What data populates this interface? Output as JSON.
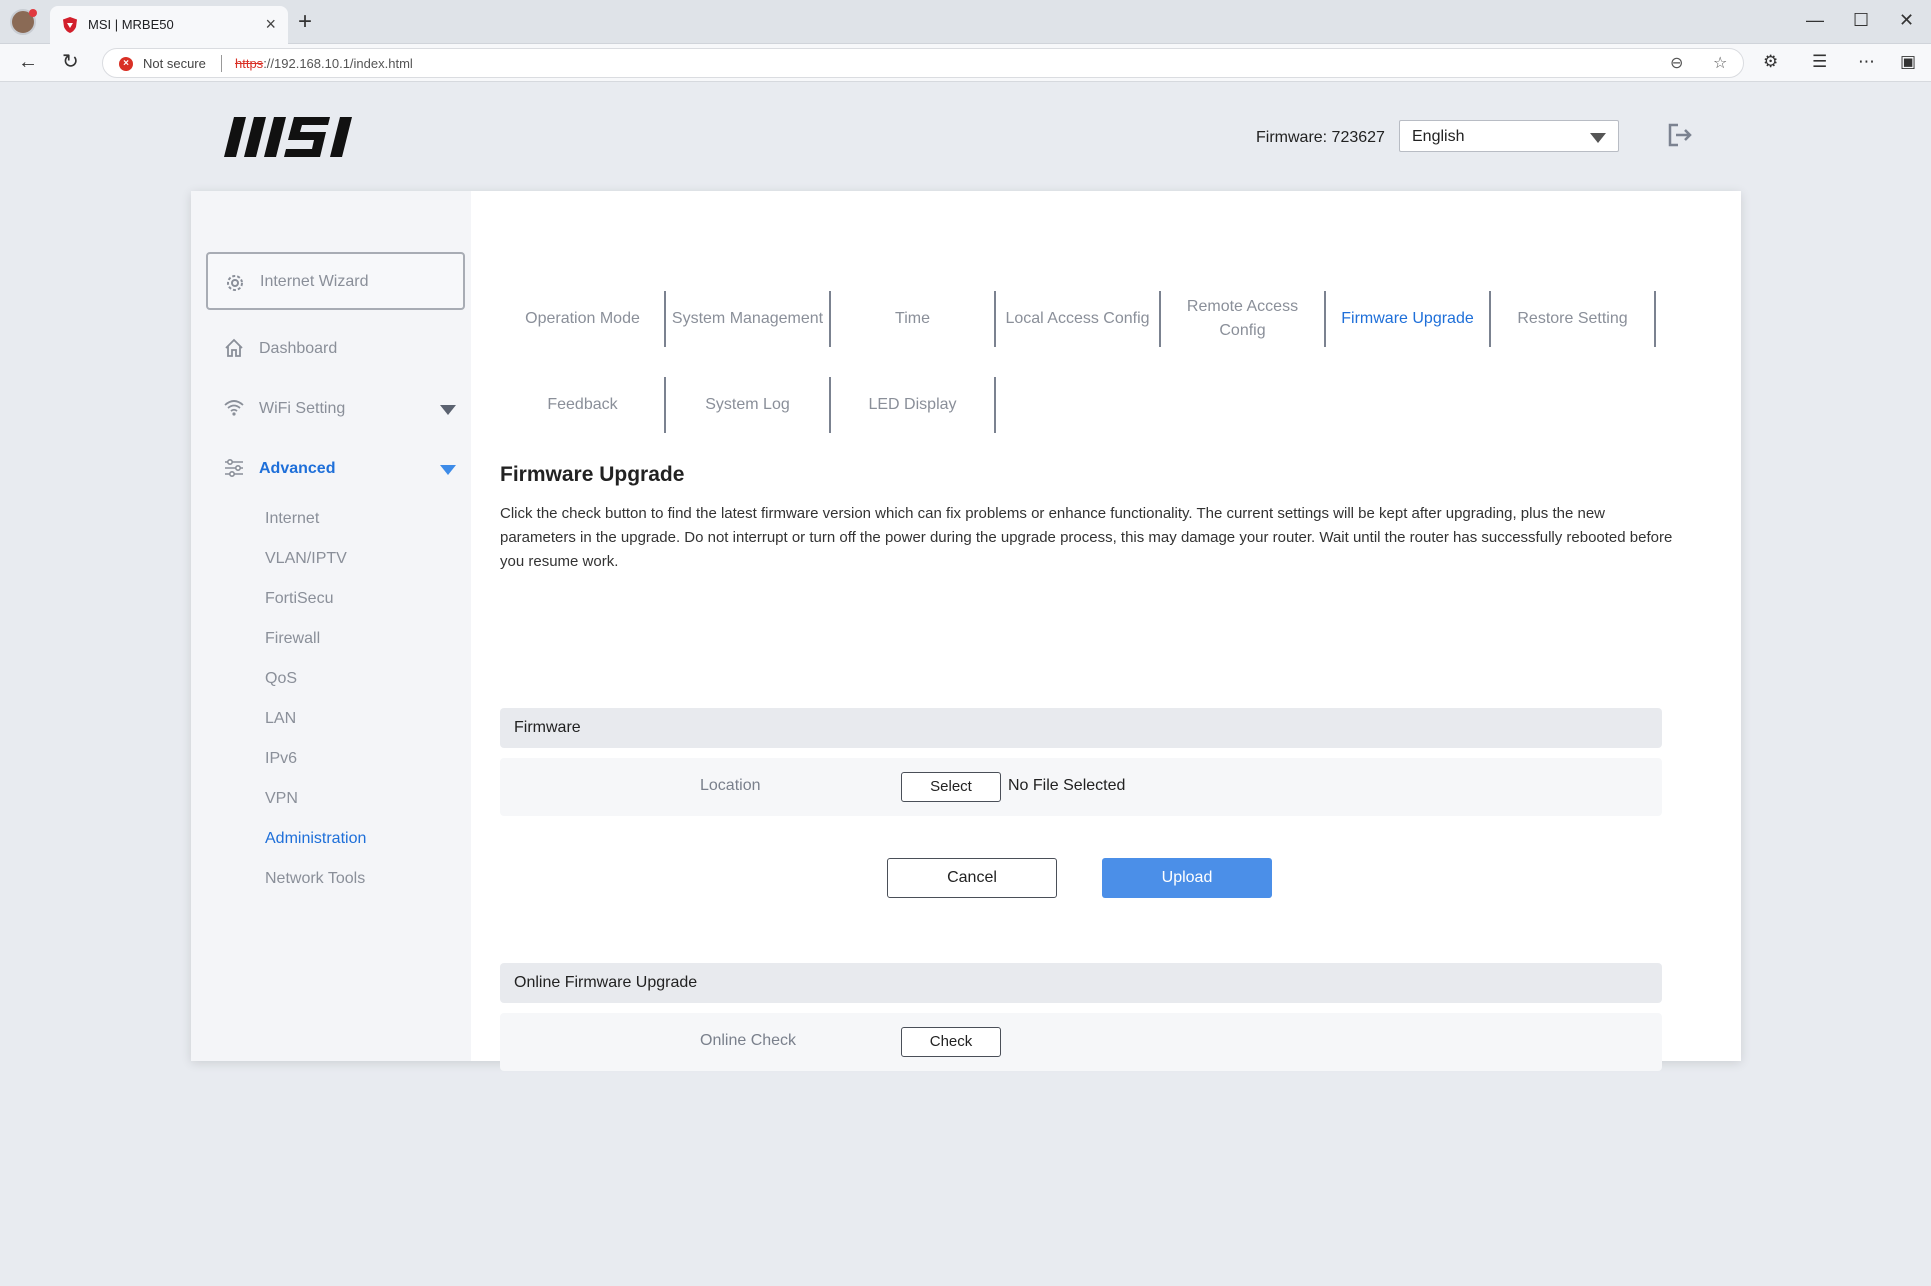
{
  "browser": {
    "tab_title": "MSI | MRBE50",
    "tab_close": "×",
    "new_tab": "+",
    "minimize": "—",
    "maximize": "☐",
    "close": "✕",
    "not_secure": "Not secure",
    "url_scheme": "https",
    "url_rest": "://192.168.10.1/index.html",
    "url_host": "192.168.10.1",
    "url_path": "/index.html"
  },
  "header": {
    "firmware_label": "Firmware: 723627",
    "language": "English"
  },
  "sidebar": {
    "wizard": "Internet Wizard",
    "dashboard": "Dashboard",
    "wifi": "WiFi Setting",
    "advanced": "Advanced",
    "sub_items": [
      "Internet",
      "VLAN/IPTV",
      "FortiSecu",
      "Firewall",
      "QoS",
      "LAN",
      "IPv6",
      "VPN",
      "Administration",
      "Network Tools"
    ]
  },
  "tabs": [
    {
      "label": "Operation Mode"
    },
    {
      "label": "System Management"
    },
    {
      "label": "Time"
    },
    {
      "label": "Local Access Config"
    },
    {
      "label": "Remote Access Config"
    },
    {
      "label": "Firmware Upgrade"
    },
    {
      "label": "Restore Setting"
    },
    {
      "label": "Feedback"
    },
    {
      "label": "System Log"
    },
    {
      "label": "LED Display"
    }
  ],
  "main": {
    "title": "Firmware Upgrade",
    "description": "Click the check button to find the latest firmware version which can fix problems or enhance functionality. The current settings will be kept after upgrading, plus the new parameters in the upgrade. Do not interrupt or turn off the power during the upgrade process, this may damage your router. Wait until the router has successfully rebooted before you resume work.",
    "firmware_section": "Firmware",
    "location_label": "Location",
    "select_button": "Select",
    "file_status": "No File Selected",
    "cancel_button": "Cancel",
    "upload_button": "Upload",
    "online_section": "Online Firmware Upgrade",
    "online_check_label": "Online Check",
    "check_button": "Check"
  },
  "colors": {
    "accent": "#1e6fd9",
    "upload_bg": "#4b8fe8",
    "sidebar_bg": "#f4f5f8"
  }
}
